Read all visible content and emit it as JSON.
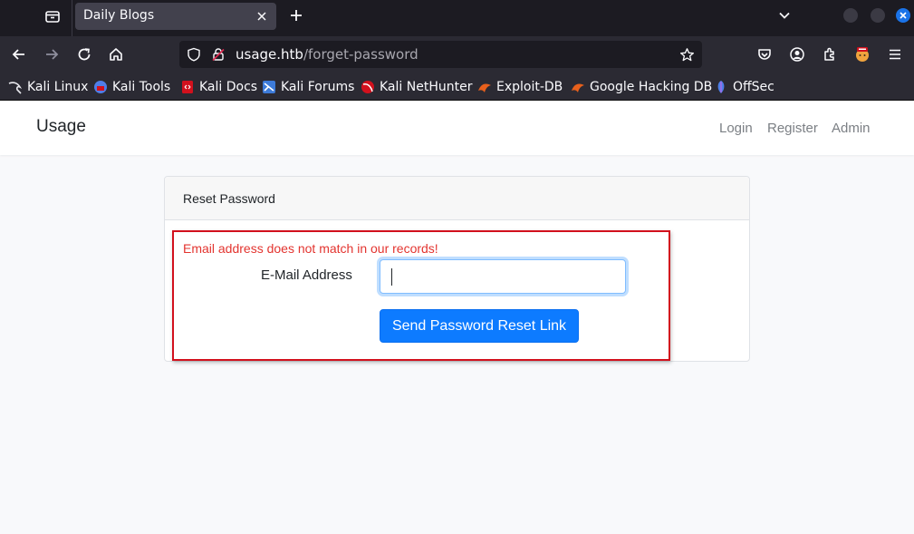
{
  "browser": {
    "tab_title": "Daily Blogs",
    "url_host": "usage.htb",
    "url_path": "/forget-password",
    "bookmarks": [
      {
        "label": "Kali Linux",
        "color": "#ffffff"
      },
      {
        "label": "Kali Tools",
        "color": "#4f7ee8"
      },
      {
        "label": "Kali Docs",
        "color": "#d2111d"
      },
      {
        "label": "Kali Forums",
        "color": "#3d7bd9"
      },
      {
        "label": "Kali NetHunter",
        "color": "#d2111d"
      },
      {
        "label": "Exploit-DB",
        "color": "#e8601c"
      },
      {
        "label": "Google Hacking DB",
        "color": "#e8601c"
      },
      {
        "label": "OffSec",
        "color": "#4f7ee8"
      }
    ],
    "icons": [
      "tab-list-icon",
      "close-icon",
      "plus-icon",
      "chevron-down-icon",
      "back-icon",
      "forward-icon",
      "reload-icon",
      "home-icon",
      "shield-icon",
      "lock-icon",
      "star-icon",
      "pocket-icon",
      "account-icon",
      "extensions-icon",
      "profile-icon",
      "menu-icon"
    ]
  },
  "site": {
    "brand": "Usage",
    "nav": {
      "login": "Login",
      "register": "Register",
      "admin": "Admin"
    }
  },
  "card": {
    "title": "Reset Password",
    "error": "Email address does not match in our records!",
    "email_label": "E-Mail Address",
    "email_value": "",
    "submit_label": "Send Password Reset Link"
  },
  "colors": {
    "accent": "#0d7bff",
    "error": "#e3342f",
    "highlight_border": "#d2111d",
    "chrome_dark": "#1c1b22"
  }
}
